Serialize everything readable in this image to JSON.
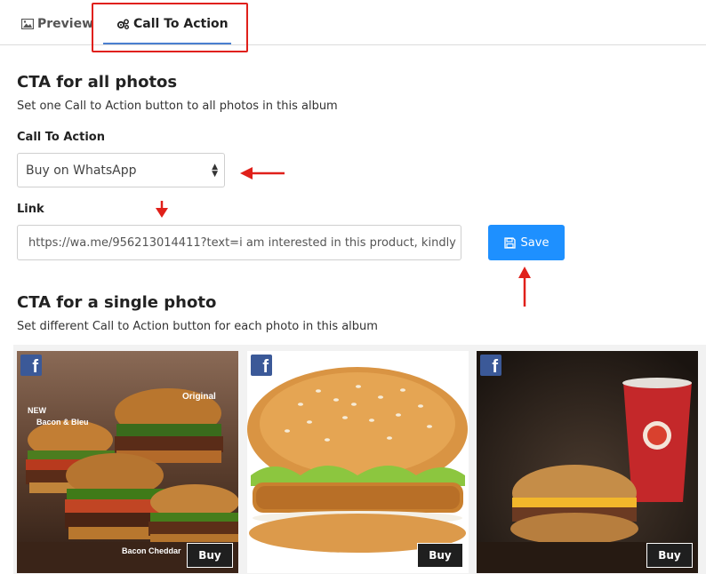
{
  "tabs": [
    {
      "label": "Preview",
      "icon": "image-icon"
    },
    {
      "label": "Call To Action",
      "icon": "gears-icon",
      "active": true
    }
  ],
  "cta_all": {
    "title": "CTA for all photos",
    "description": "Set one Call to Action button to all photos in this album",
    "action_label": "Call To Action",
    "action_value": "Buy on WhatsApp",
    "link_label": "Link",
    "link_value": "https://wa.me/956213014411?text=i am interested in this product, kindly",
    "save_label": "Save"
  },
  "cta_single": {
    "title": "CTA for a single photo",
    "description": "Set different Call to Action button for each photo in this album"
  },
  "photos": [
    {
      "buy_label": "Buy",
      "caption_new": "NEW",
      "caption_1": "Bacon & Bleu",
      "caption_2": "Original",
      "caption_3": "Bacon Cheddar"
    },
    {
      "buy_label": "Buy"
    },
    {
      "buy_label": "Buy"
    }
  ],
  "colors": {
    "accent": "#1e90ff",
    "annotation": "#e0201a",
    "facebook": "#3b5998"
  }
}
